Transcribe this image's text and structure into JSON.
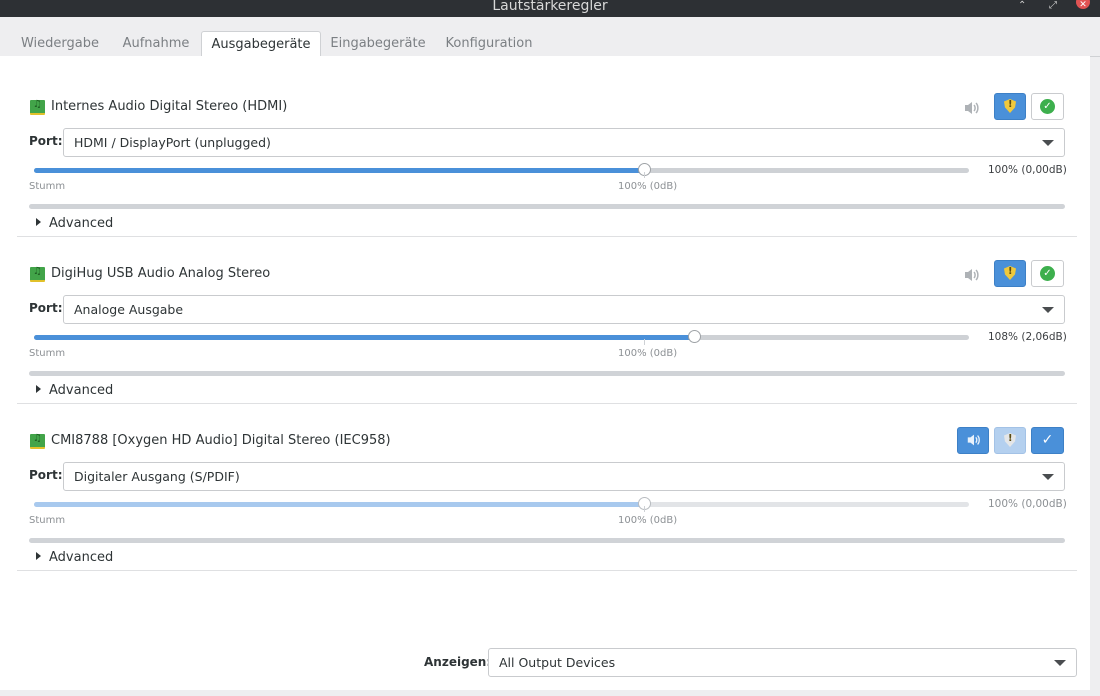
{
  "window": {
    "title": "Lautstärkeregler"
  },
  "tabs": [
    {
      "label": "Wiedergabe"
    },
    {
      "label": "Aufnahme"
    },
    {
      "label": "Ausgabegeräte",
      "active": true
    },
    {
      "label": "Eingabegeräte"
    },
    {
      "label": "Konfiguration"
    }
  ],
  "port_label": "Port:",
  "slider_min_label": "Stumm",
  "slider_mid_label": "100% (0dB)",
  "advanced_label": "Advanced",
  "devices": [
    {
      "name": "Internes Audio Digital Stereo (HDMI)",
      "port": "HDMI / DisplayPort (unplugged)",
      "volume_value": "100% (0,00dB)",
      "volume_fraction": 0.653,
      "muted": false,
      "locked": true,
      "default": false
    },
    {
      "name": "DigiHug USB Audio Analog Stereo",
      "port": "Analoge Ausgabe",
      "volume_value": "108% (2,06dB)",
      "volume_fraction": 0.707,
      "muted": false,
      "locked": true,
      "default": false
    },
    {
      "name": "CMI8788 [Oxygen HD Audio] Digital Stereo (IEC958)",
      "port": "Digitaler Ausgang (S/PDIF)",
      "volume_value": "100% (0,00dB)",
      "volume_fraction": 0.653,
      "muted": true,
      "locked": false,
      "default": true
    }
  ],
  "footer": {
    "show_label": "Anzeigen:",
    "show_value": "All Output Devices"
  },
  "colors": {
    "accent": "#4a90d9",
    "check": "#3daf4d",
    "lock": "#f0c93c"
  },
  "icons": {
    "device": "sound-card-icon",
    "speaker": "speaker-icon",
    "lock": "shield-lock-icon",
    "default": "checkmark-icon"
  }
}
